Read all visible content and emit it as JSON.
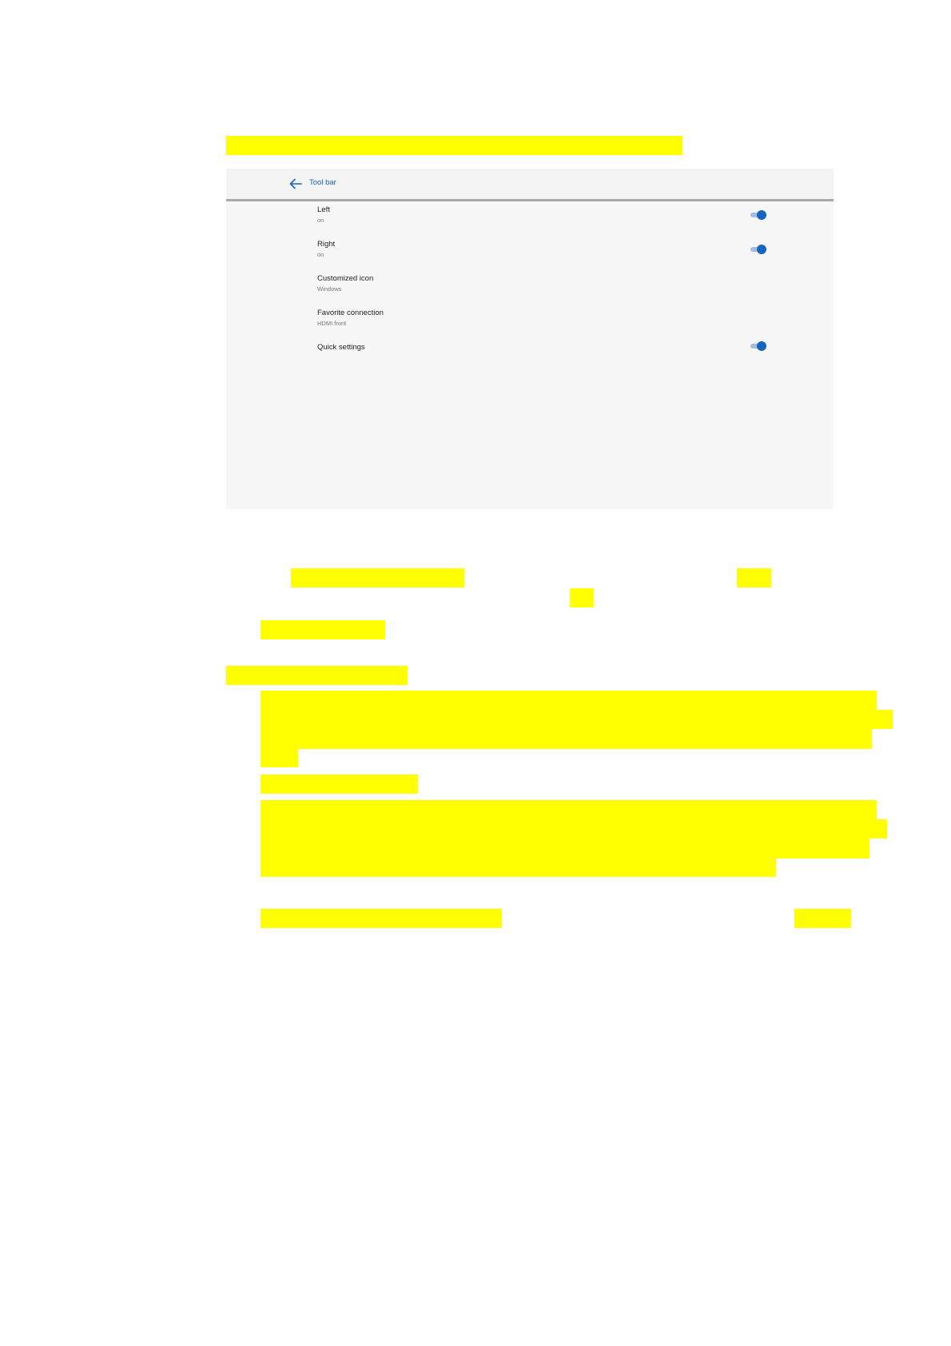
{
  "toolbar_screen": {
    "title": "Tool bar",
    "back_icon": "arrow-left-icon",
    "accent_color": "#1565c0",
    "items": [
      {
        "title": "Left",
        "subtitle": "on",
        "toggle": true,
        "on": true
      },
      {
        "title": "Right",
        "subtitle": "on",
        "toggle": true,
        "on": true
      },
      {
        "title": "Customized icon",
        "subtitle": "Windows",
        "toggle": false
      },
      {
        "title": "Favorite connection",
        "subtitle": "HDMI front",
        "toggle": false
      },
      {
        "title": "Quick settings",
        "subtitle": "",
        "toggle": true,
        "on": true
      }
    ]
  },
  "highlight_color": "#ffff00"
}
